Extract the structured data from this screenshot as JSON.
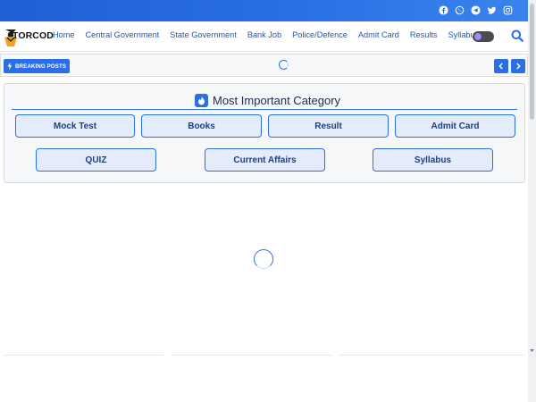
{
  "social": [
    "facebook-icon",
    "whatsapp-icon",
    "telegram-icon",
    "twitter-icon",
    "instagram-icon"
  ],
  "logo_text": "TORCOD",
  "nav": {
    "home": "Home",
    "central": "Central Government",
    "state": "State Government",
    "bank": "Bank Job",
    "police": "Police/Defence",
    "admit": "Admit Card",
    "results": "Results",
    "syllabus": "Syllabus"
  },
  "breaking": {
    "label": "BREAKING POSTS"
  },
  "category": {
    "title": "Most Important Category",
    "row1": [
      "Mock Test",
      "Books",
      "Result",
      "Admit Card"
    ],
    "row2": [
      "QUIZ",
      "Current Affairs",
      "Syllabus"
    ]
  },
  "colors": {
    "accent": "#2a6fe6",
    "topbar": "#1f5fd6",
    "pill_bg": "#e4ecfb"
  }
}
